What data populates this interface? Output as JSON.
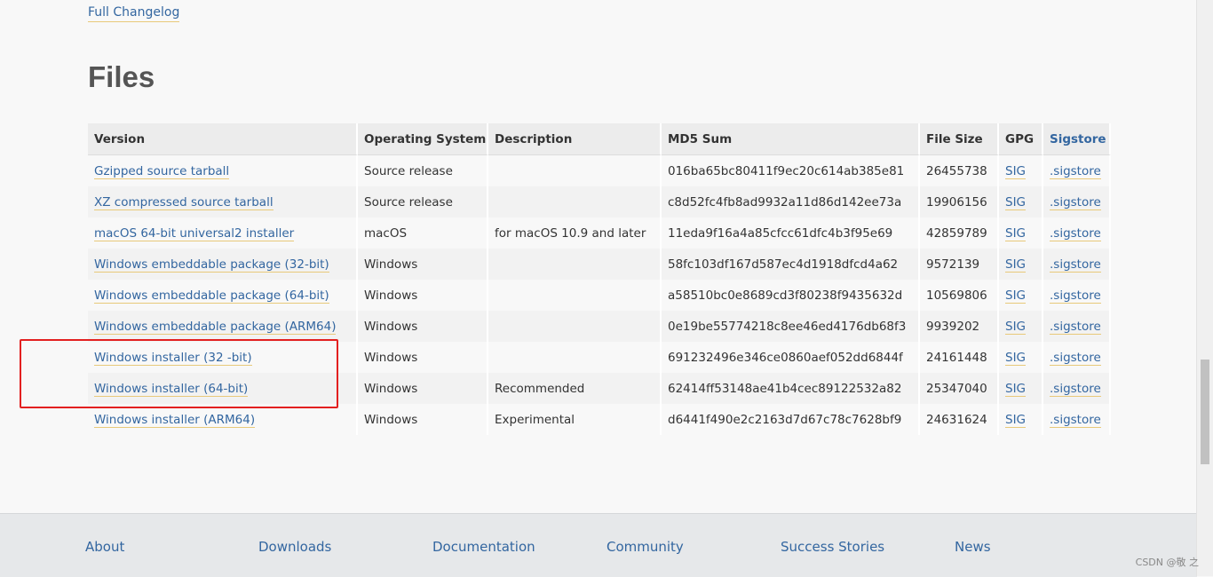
{
  "changelog_link": "Full Changelog",
  "heading": "Files",
  "table": {
    "headers": [
      "Version",
      "Operating System",
      "Description",
      "MD5 Sum",
      "File Size",
      "GPG",
      "Sigstore"
    ],
    "rows": [
      {
        "version": "Gzipped source tarball",
        "os": "Source release",
        "description": "",
        "md5": "016ba65bc80411f9ec20c614ab385e81",
        "size": "26455738",
        "gpg": "SIG",
        "sigstore": ".sigstore"
      },
      {
        "version": "XZ compressed source tarball",
        "os": "Source release",
        "description": "",
        "md5": "c8d52fc4fb8ad9932a11d86d142ee73a",
        "size": "19906156",
        "gpg": "SIG",
        "sigstore": ".sigstore"
      },
      {
        "version": "macOS 64-bit universal2 installer",
        "os": "macOS",
        "description": "for macOS 10.9 and later",
        "md5": "11eda9f16a4a85cfcc61dfc4b3f95e69",
        "size": "42859789",
        "gpg": "SIG",
        "sigstore": ".sigstore"
      },
      {
        "version": "Windows embeddable package (32-bit)",
        "os": "Windows",
        "description": "",
        "md5": "58fc103df167d587ec4d1918dfcd4a62",
        "size": "9572139",
        "gpg": "SIG",
        "sigstore": ".sigstore"
      },
      {
        "version": "Windows embeddable package (64-bit)",
        "os": "Windows",
        "description": "",
        "md5": "a58510bc0e8689cd3f80238f9435632d",
        "size": "10569806",
        "gpg": "SIG",
        "sigstore": ".sigstore"
      },
      {
        "version": "Windows embeddable package (ARM64)",
        "os": "Windows",
        "description": "",
        "md5": "0e19be55774218c8ee46ed4176db68f3",
        "size": "9939202",
        "gpg": "SIG",
        "sigstore": ".sigstore"
      },
      {
        "version": "Windows installer (32 -bit)",
        "os": "Windows",
        "description": "",
        "md5": "691232496e346ce0860aef052dd6844f",
        "size": "24161448",
        "gpg": "SIG",
        "sigstore": ".sigstore"
      },
      {
        "version": "Windows installer (64-bit)",
        "os": "Windows",
        "description": "Recommended",
        "md5": "62414ff53148ae41b4cec89122532a82",
        "size": "25347040",
        "gpg": "SIG",
        "sigstore": ".sigstore"
      },
      {
        "version": "Windows installer (ARM64)",
        "os": "Windows",
        "description": "Experimental",
        "md5": "d6441f490e2c2163d7d67c78c7628bf9",
        "size": "24631624",
        "gpg": "SIG",
        "sigstore": ".sigstore"
      }
    ]
  },
  "footer": {
    "links": [
      "About",
      "Downloads",
      "Documentation",
      "Community",
      "Success Stories",
      "News"
    ]
  },
  "watermark": "CSDN @敬 之",
  "colors": {
    "link": "#3366a0",
    "highlight": "#e32020",
    "underline": "#e8c97a"
  }
}
